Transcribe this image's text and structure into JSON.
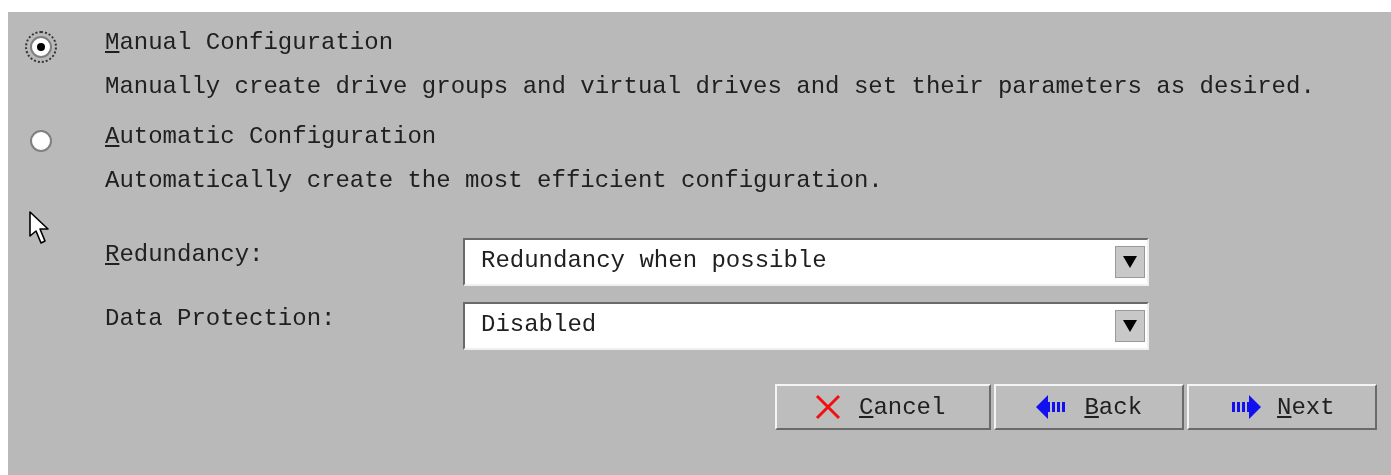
{
  "options": [
    {
      "label": "Manual Configuration",
      "description": "Manually create drive groups and virtual drives and set their parameters as desired.",
      "selected": true
    },
    {
      "label": "Automatic Configuration",
      "description": "Automatically create the most efficient configuration.",
      "selected": false
    }
  ],
  "settings": [
    {
      "label": "Redundancy:",
      "value": "Redundancy when possible"
    },
    {
      "label": "Data Protection:",
      "value": "Disabled"
    }
  ],
  "buttons": [
    {
      "kind": "cancel",
      "label": "Cancel"
    },
    {
      "kind": "back",
      "label": "Back"
    },
    {
      "kind": "next",
      "label": "Next"
    }
  ]
}
